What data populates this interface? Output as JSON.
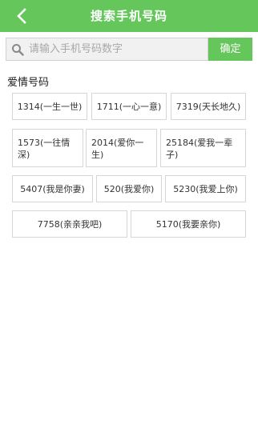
{
  "header": {
    "title": "搜索手机号码"
  },
  "search": {
    "placeholder": "请输入手机号码数字",
    "value": "",
    "confirm_label": "确定"
  },
  "section": {
    "title": "爱情号码"
  },
  "numbers": [
    {
      "label": "1314(一生一世)"
    },
    {
      "label": "1711(一心一意)"
    },
    {
      "label": "7319(天长地久)"
    },
    {
      "label": "1573(一往情深)"
    },
    {
      "label": "2014(爱你一生)"
    },
    {
      "label": "25184(爱我一辈子)"
    },
    {
      "label": "5407(我是你妻)"
    },
    {
      "label": "520(我爱你)"
    },
    {
      "label": "5230(我爱上你)"
    },
    {
      "label": "7758(亲亲我吧)"
    },
    {
      "label": "5170(我要亲你)"
    }
  ],
  "colors": {
    "accent": "#65c65c",
    "border": "#d6d6d6"
  },
  "icons": {
    "back": "chevron-left-icon",
    "search": "search-icon"
  }
}
